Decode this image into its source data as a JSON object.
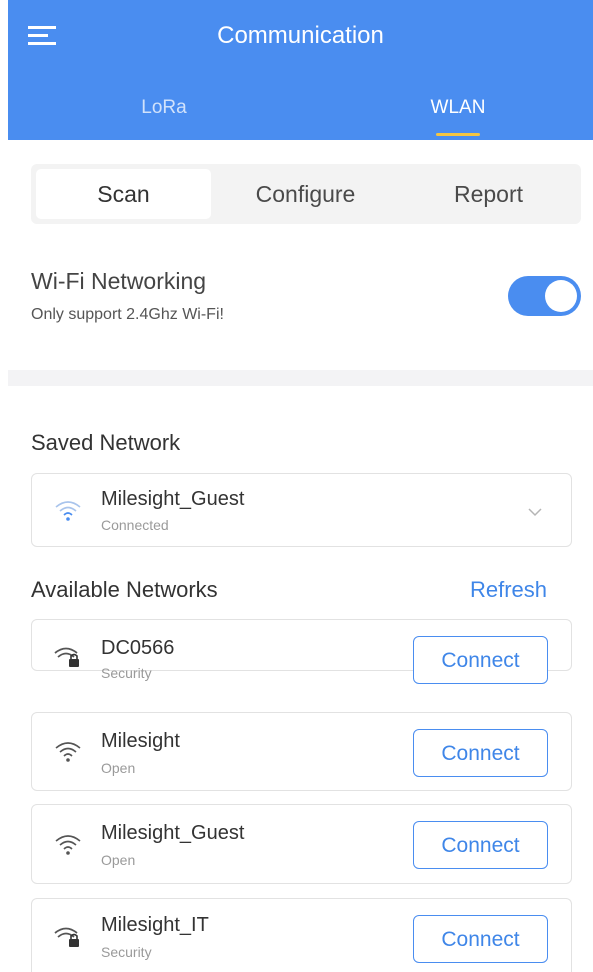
{
  "header": {
    "title": "Communication",
    "tabs": [
      {
        "label": "LoRa",
        "active": false
      },
      {
        "label": "WLAN",
        "active": true
      }
    ]
  },
  "segments": [
    {
      "label": "Scan",
      "active": true
    },
    {
      "label": "Configure",
      "active": false
    },
    {
      "label": "Report",
      "active": false
    }
  ],
  "wifi_networking": {
    "title": "Wi-Fi Networking",
    "subtitle": "Only support 2.4Ghz Wi-Fi!",
    "enabled": true
  },
  "saved_network": {
    "section_label": "Saved Network",
    "name": "Milesight_Guest",
    "status": "Connected",
    "icon": "wifi-icon"
  },
  "available_networks": {
    "section_label": "Available Networks",
    "refresh_label": "Refresh",
    "items": [
      {
        "name": "DC0566",
        "security": "Security",
        "icon": "wifi-lock-icon",
        "button": "Connect"
      },
      {
        "name": "Milesight",
        "security": "Open",
        "icon": "wifi-icon",
        "button": "Connect"
      },
      {
        "name": "Milesight_Guest",
        "security": "Open",
        "icon": "wifi-icon",
        "button": "Connect"
      },
      {
        "name": "Milesight_IT",
        "security": "Security",
        "icon": "wifi-lock-icon",
        "button": "Connect"
      }
    ]
  },
  "colors": {
    "accent": "#4a8df0",
    "tab_indicator": "#f4c542"
  }
}
